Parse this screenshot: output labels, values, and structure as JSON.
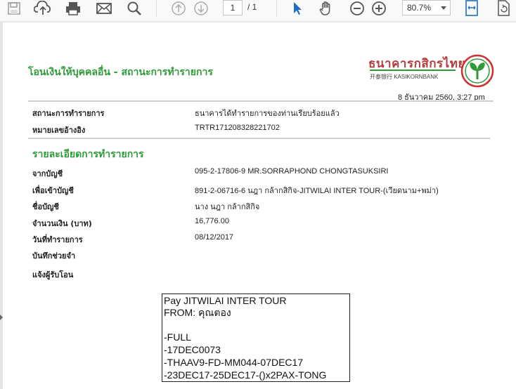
{
  "toolbar": {
    "page_current": "1",
    "page_total": "/ 1",
    "zoom": "80.7%"
  },
  "document": {
    "title": "โอนเงินให้บุคคลอื่น - สถานะการทำรายการ",
    "bank": {
      "name_th": "ธนาคารกสิกรไทย",
      "name_en": "开泰银行 KASIKORNBANK"
    },
    "timestamp": "8 ธันวาคม 2560, 3:27 pm",
    "status": {
      "label": "สถานะการทำรายการ",
      "value": "ธนาคารได้ทำรายการของท่านเรียบร้อยแล้ว"
    },
    "reference": {
      "label": "หมายเลขอ้างอิง",
      "value": "TRTR171208328221702"
    },
    "details_heading": "รายละเอียดการทำรายการ",
    "details": [
      {
        "label": "จากบัญชี",
        "value": "095-2-17806-9 MR.SORRAPHOND CHONGTASUKSIRI"
      },
      {
        "label": "เพื่อเข้าบัญชี",
        "value": "891-2-06716-6 นฎา กล้ากสิกิจ-JITWILAI INTER TOUR-(เวียดนาม+พม่า)"
      },
      {
        "label": "ชื่อบัญชี",
        "value": "นาง นฎา กล้ากสิกิจ"
      },
      {
        "label": "จำนวนเงิน (บาท)",
        "value": "16,776.00"
      },
      {
        "label": "วันที่ทำรายการ",
        "value": "08/12/2017"
      },
      {
        "label": "บันทึกช่วยจำ",
        "value": ""
      },
      {
        "label": "แจ้งผู้รับโอน",
        "value": ""
      }
    ],
    "memo_lines": [
      "Pay JITWILAI INTER TOUR",
      "FROM: คุณตอง",
      "",
      "-FULL",
      "-17DEC0073",
      "-THAAV9-FD-MM044-07DEC17",
      "-23DEC17-25DEC17-()x2PAX-TONG"
    ]
  },
  "colors": {
    "accent_green": "#2e9a3a",
    "bank_red": "#b43c3c",
    "toolbar_blue": "#1f6fbf"
  }
}
